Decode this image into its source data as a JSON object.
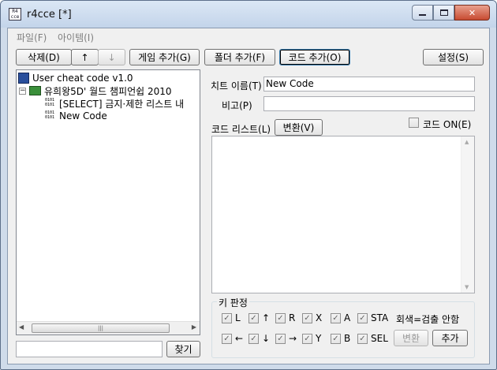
{
  "window": {
    "title": "r4cce [*]",
    "app_icon_text": "R4\ncce"
  },
  "menu": {
    "file": "파일(F)",
    "items": "아이템(I)"
  },
  "toolbar": {
    "delete": "삭제(D)",
    "up": "↑",
    "down": "↓",
    "add_game": "게임 추가(G)",
    "add_folder": "폴더 추가(F)",
    "add_code": "코드 추가(O)",
    "settings": "설정(S)"
  },
  "tree": {
    "root": "User cheat code v1.0",
    "game": "유희왕5D' 월드 챔피언쉽 2010",
    "children": [
      "[SELECT] 금지·제한 리스트 내",
      "New Code"
    ]
  },
  "search": {
    "value": "",
    "button": "찾기"
  },
  "detail": {
    "cheat_name_label": "치트 이름(T)",
    "cheat_name_value": "New Code",
    "note_label": "비고(P)",
    "note_value": "",
    "code_list_label": "코드 리스트(L)",
    "convert_button": "변환(V)",
    "code_on_label": "코드 ON(E)"
  },
  "keys": {
    "group_title": "키 판정",
    "row1": [
      "L",
      "↑",
      "R",
      "X",
      "A",
      "STA"
    ],
    "row2": [
      "←",
      "↓",
      "→",
      "Y",
      "B",
      "SEL"
    ],
    "hint": "회색=검출 안함",
    "convert_button": "변환",
    "add_button": "추가"
  },
  "icons": {
    "minimize": "minimize-icon",
    "maximize": "maximize-icon",
    "close": "close-icon",
    "scroll_left": "◀",
    "scroll_right": "▶",
    "scroll_up": "▲",
    "scroll_down": "▼",
    "grip": "|||"
  }
}
